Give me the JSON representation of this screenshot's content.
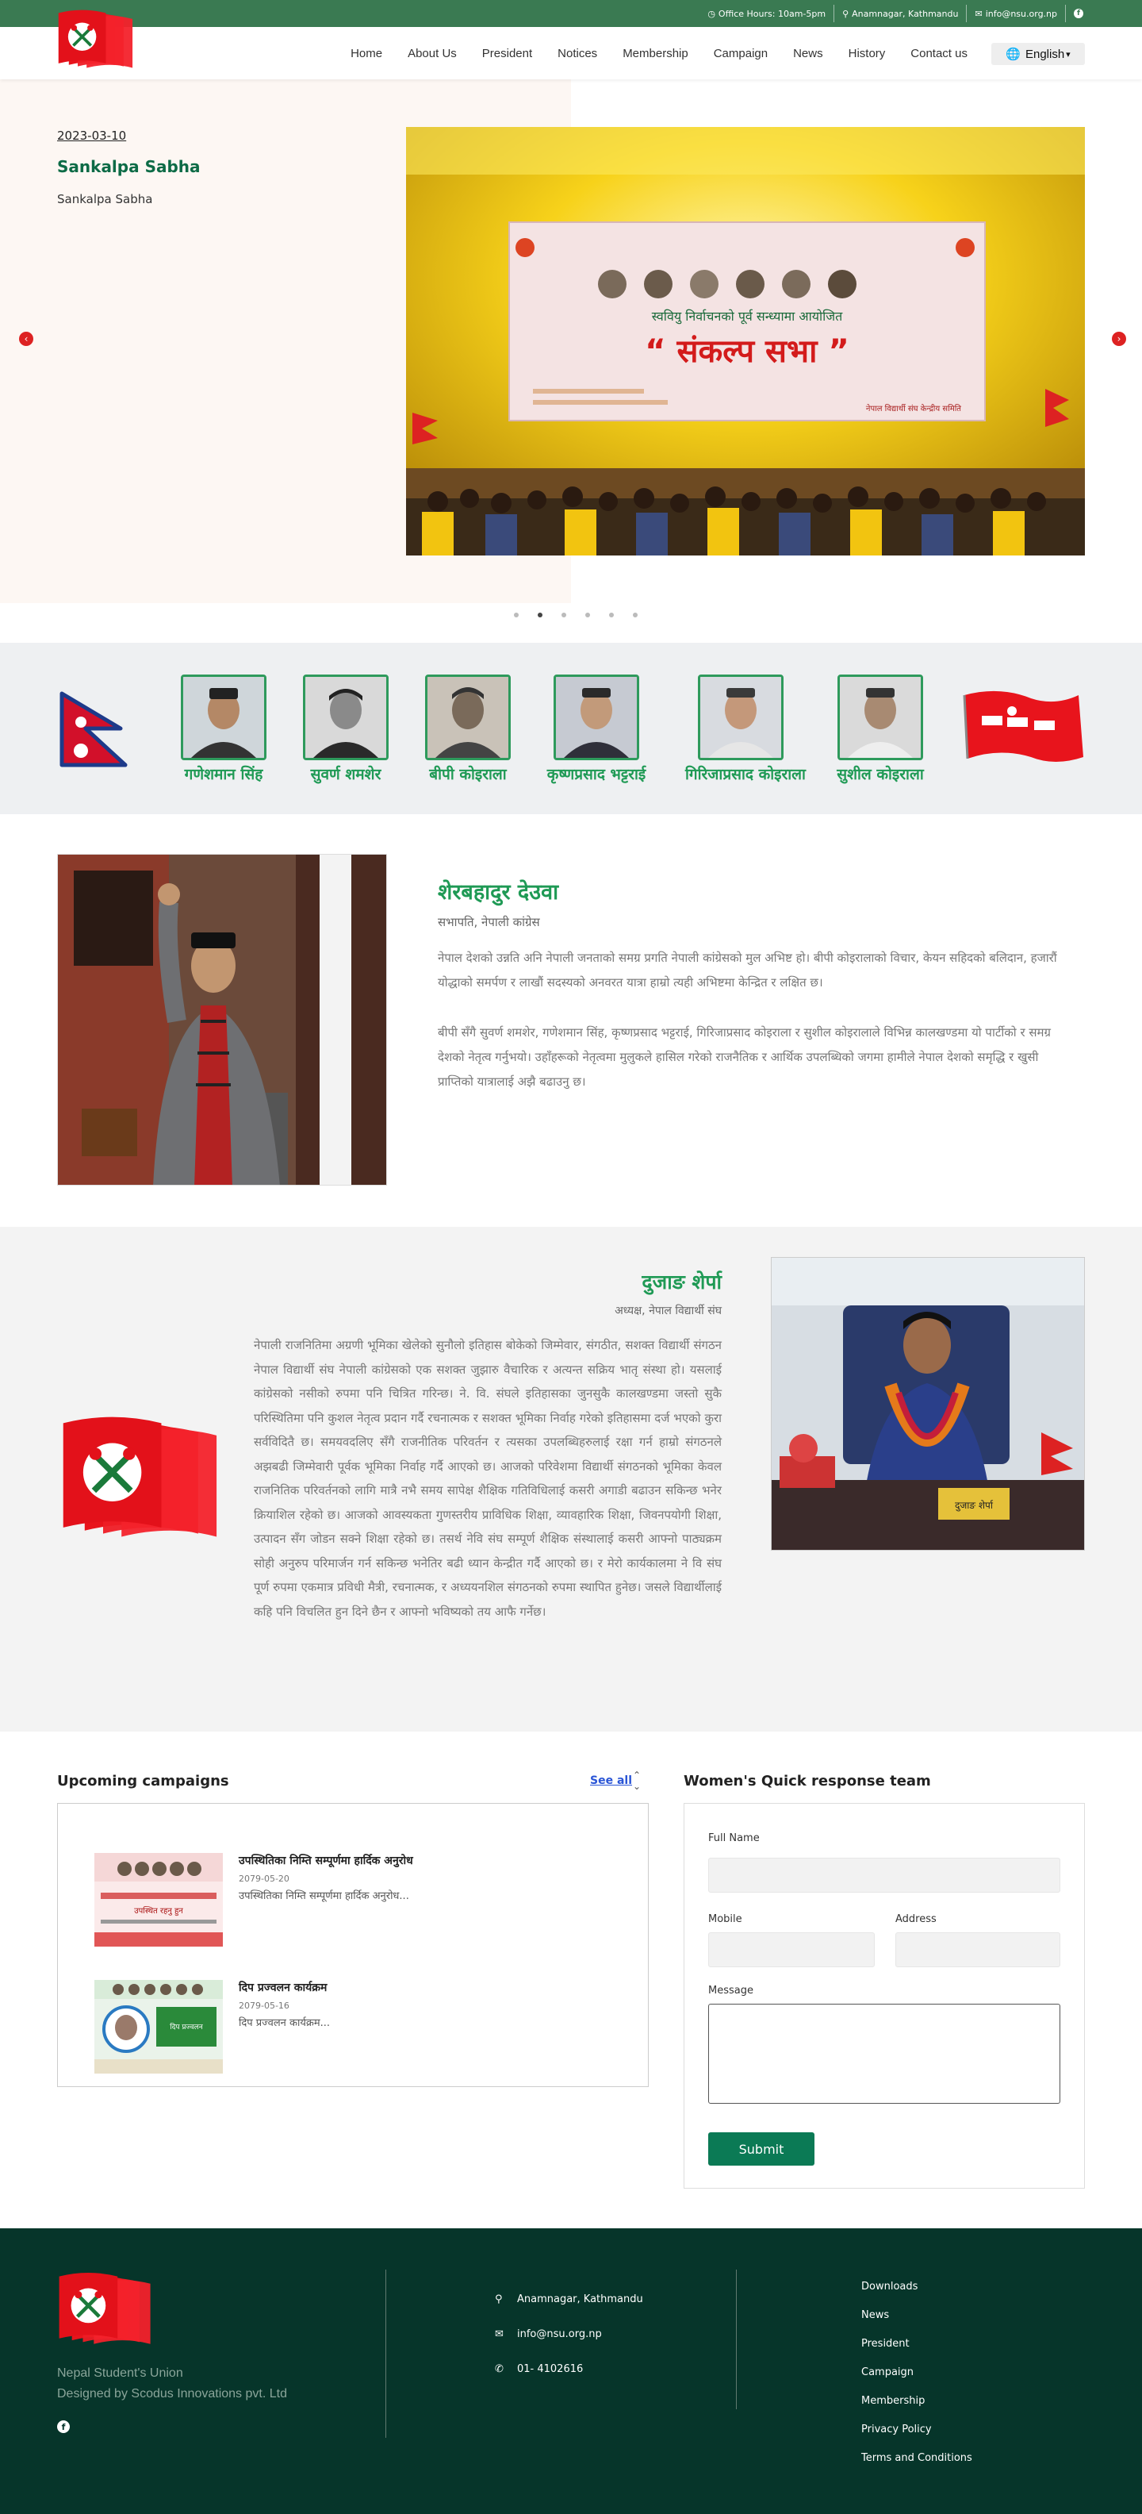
{
  "topbar": {
    "office_hours": "Office Hours: 10am-5pm",
    "location": "Anamnagar, Kathmandu",
    "email": "info@nsu.org.np",
    "bg_color": "#3a7a52"
  },
  "nav": {
    "items": [
      "Home",
      "About Us",
      "President",
      "Notices",
      "Membership",
      "Campaign",
      "News",
      "History",
      "Contact us"
    ],
    "language": "English"
  },
  "hero": {
    "date": "2023-03-10",
    "title": "Sankalpa Sabha",
    "subtitle": "Sankalpa Sabha",
    "banner_heading": "स्ववियु निर्वाचनको पूर्व सन्ध्यामा आयोजित",
    "banner_title": "“ संकल्प सभा ”",
    "banner_org": "नेपाल विद्यार्थी संघ केन्द्रीय समिति",
    "slide_count": 6,
    "active_slide": 2
  },
  "leaders": {
    "names": [
      "गणेशमान सिंह",
      "सुवर्ण शमशेर",
      "बीपी कोइराला",
      "कृष्णप्रसाद भट्टराई",
      "गिरिजाप्रसाद कोइराला",
      "सुशील कोइराला"
    ]
  },
  "president": {
    "name": "शेरबहादुर देउवा",
    "role": "सभापति, नेपाली कांग्रेस",
    "para1": "नेपाल देशको उन्नति अनि नेपाली जनताको समग्र प्रगति नेपाली कांग्रेसको मुल अभिष्ट हो। बीपी कोइरालाको विचार, केयन सहिदको बलिदान, हजारौं योद्धाको समर्पण र लाखौं सदस्यको अनवरत यात्रा हाम्रो त्यही अभिष्टमा केन्द्रित र लक्षित छ।",
    "para2": "बीपी सँगै सुवर्ण शमशेर, गणेशमान सिंह, कृष्णप्रसाद भट्टराई, गिरिजाप्रसाद कोइराला र सुशील कोइरालाले विभिन्न कालखण्डमा यो पार्टीको र समग्र देशको नेतृत्व गर्नुभयो। उहाँहरूको नेतृत्वमा मुलुकले हासिल गरेको राजनैतिक र आर्थिक उपलब्धिको जगमा हामीले नेपाल देशको समृद्धि र खुसी प्राप्तिको यात्रालाई अझै बढाउनु छ।"
  },
  "nsu_leader": {
    "name": "दुजाङ शेर्पा",
    "role": "अध्यक्ष, नेपाल विद्यार्थी संघ",
    "nameplate": "दुजाङ शेर्पा",
    "body": "नेपाली राजनितिमा अग्रणी भूमिका खेलेको सुनौलो इतिहास बोकेको जिम्मेवार, संगठीत, सशक्त विद्यार्थी संगठन नेपाल विद्यार्थी संघ नेपाली कांग्रेसको एक सशक्त जुझारु वैचारिक र अत्यन्त सक्रिय भातृ संस्था हो। यसलाई कांग्रेसको नसीको रुपमा पनि चित्रित गरिन्छ। ने. वि. संघले इतिहासका जुनसुकै कालखण्डमा जस्तो सुकै परिस्थितिमा पनि कुशल नेतृत्व प्रदान गर्दै रचनात्मक र सशक्त भूमिका निर्वाह गरेको इतिहासमा दर्ज भएको कुरा सर्वविदितै छ। समयवदलिए सँगै राजनीतिक परिवर्तन र त्यसका उपलब्धिहरुलाई रक्षा गर्न हाम्रो संगठनले अझबढी जिम्मेवारी पूर्वक भूमिका निर्वाह गर्दै आएको छ। आजको परिवेशमा विद्यार्थी संगठनको भूमिका केवल राजनितिक परिवर्तनको लागि मात्रै नभै समय सापेक्ष शैक्षिक गतिविधिलाई कसरी अगाडी बढाउन सकिन्छ भनेर क्रियाशिल रहेको छ। आजको आवस्यकता गुणस्तरीय प्राविधिक शिक्षा, व्यावहारिक शिक्षा, जिवनपयोगी शिक्षा, उत्पादन सँग जोडन सक्ने शिक्षा रहेको छ। तसर्थ नेवि संघ सम्पूर्ण शैक्षिक संस्थालाई कसरी आफ्नो पाठ्यक्रम सोही अनुरुप परिमार्जन गर्न सकिन्छ भनेतिर बढी ध्यान केन्द्रीत गर्दै आएको छ। र मेरो कार्यकालमा ने वि संघ पूर्ण रुपमा एकमात्र प्रविधी मैत्री, रचनात्मक, र अध्ययनशिल संगठनको रुपमा स्थापित हुनेछ। जसले विद्यार्थीलाई कहि पनि विचलित हुन दिने छैन र आफ्नो भविष्यको तय आफै गर्नेछ।"
  },
  "campaigns": {
    "title": "Upcoming campaigns",
    "see_all": "See all",
    "items": [
      {
        "title": "उपस्थितिका निम्ति सम्पूर्णमा हार्दिक अनुरोध",
        "date": "2079-05-20",
        "excerpt": "उपस्थितिका निम्ति सम्पूर्णमा हार्दिक अनुरोध...",
        "thumb_text": "उपस्थित रहनु हुन"
      },
      {
        "title": "दिप प्रज्वलन कार्यक्रम",
        "date": "2079-05-16",
        "excerpt": "दिप प्रज्वलन कार्यक्रम...",
        "thumb_text": "दिप प्रज्वलन"
      }
    ]
  },
  "form": {
    "title": "Women's Quick response team",
    "full_name_label": "Full Name",
    "mobile_label": "Mobile",
    "address_label": "Address",
    "message_label": "Message",
    "submit": "Submit"
  },
  "footer": {
    "org_name": "Nepal Student's Union",
    "credit": "Designed by Scodus Innovations pvt. Ltd",
    "address": "Anamnagar, Kathmandu",
    "email": "info@nsu.org.np",
    "phone": "01- 4102616",
    "links": [
      "Downloads",
      "News",
      "President",
      "Campaign",
      "Membership",
      "Privacy Policy",
      "Terms and Conditions"
    ],
    "bg_color": "#06352a"
  },
  "colors": {
    "brand_green": "#1f9a55",
    "brand_red": "#e8141c",
    "submit_green": "#0b7a55"
  }
}
